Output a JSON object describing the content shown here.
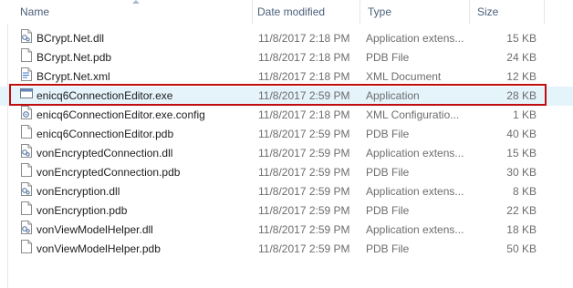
{
  "columns": {
    "name": "Name",
    "date": "Date modified",
    "type": "Type",
    "size": "Size"
  },
  "files": [
    {
      "name": "BCrypt.Net.dll",
      "date": "11/8/2017 2:18 PM",
      "type": "Application extens...",
      "size": "15 KB",
      "icon": "dll-icon"
    },
    {
      "name": "BCrypt.Net.pdb",
      "date": "11/8/2017 2:18 PM",
      "type": "PDB File",
      "size": "24 KB",
      "icon": "file-icon"
    },
    {
      "name": "BCrypt.Net.xml",
      "date": "11/8/2017 2:18 PM",
      "type": "XML Document",
      "size": "12 KB",
      "icon": "xml-icon"
    },
    {
      "name": "enicq6ConnectionEditor.exe",
      "date": "11/8/2017 2:59 PM",
      "type": "Application",
      "size": "28 KB",
      "icon": "exe-icon",
      "selected": true
    },
    {
      "name": "enicq6ConnectionEditor.exe.config",
      "date": "11/8/2017 2:18 PM",
      "type": "XML Configuratio...",
      "size": "1 KB",
      "icon": "config-icon"
    },
    {
      "name": "enicq6ConnectionEditor.pdb",
      "date": "11/8/2017 2:59 PM",
      "type": "PDB File",
      "size": "40 KB",
      "icon": "file-icon"
    },
    {
      "name": "vonEncryptedConnection.dll",
      "date": "11/8/2017 2:59 PM",
      "type": "Application extens...",
      "size": "15 KB",
      "icon": "dll-icon"
    },
    {
      "name": "vonEncryptedConnection.pdb",
      "date": "11/8/2017 2:59 PM",
      "type": "PDB File",
      "size": "30 KB",
      "icon": "file-icon"
    },
    {
      "name": "vonEncryption.dll",
      "date": "11/8/2017 2:59 PM",
      "type": "Application extens...",
      "size": "8 KB",
      "icon": "dll-icon"
    },
    {
      "name": "vonEncryption.pdb",
      "date": "11/8/2017 2:59 PM",
      "type": "PDB File",
      "size": "22 KB",
      "icon": "file-icon"
    },
    {
      "name": "vonViewModelHelper.dll",
      "date": "11/8/2017 2:59 PM",
      "type": "Application extens...",
      "size": "18 KB",
      "icon": "dll-icon"
    },
    {
      "name": "vonViewModelHelper.pdb",
      "date": "11/8/2017 2:59 PM",
      "type": "PDB File",
      "size": "50 KB",
      "icon": "file-icon"
    }
  ],
  "colors": {
    "header_text": "#4c607a",
    "selection_bg": "#e5f3fb",
    "highlight_border": "#c00d0d"
  }
}
